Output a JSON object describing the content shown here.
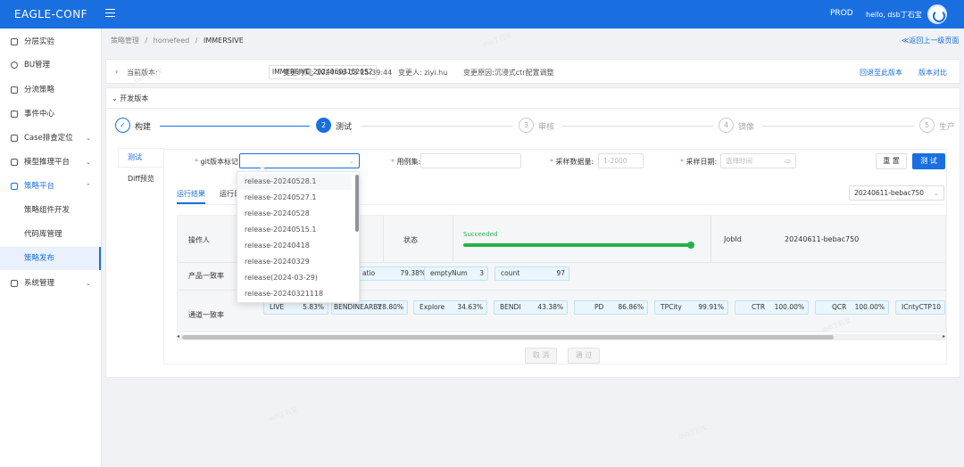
{
  "header": {
    "brand": "EAGLE-CONF",
    "env": "PROD",
    "greeting": "hello, dsb丁石宝"
  },
  "sidebar": {
    "items": [
      {
        "label": "分层实验",
        "icon": "layers-icon",
        "chevron": ""
      },
      {
        "label": "BU管理",
        "icon": "globe-icon",
        "chevron": ""
      },
      {
        "label": "分流策略",
        "icon": "branch-icon",
        "chevron": ""
      },
      {
        "label": "事件中心",
        "icon": "calendar-icon",
        "chevron": ""
      },
      {
        "label": "Case排查定位",
        "icon": "case-icon",
        "chevron": "⌄"
      },
      {
        "label": "模型推理平台",
        "icon": "model-icon",
        "chevron": "⌄"
      },
      {
        "label": "策略平台",
        "icon": "strategy-icon",
        "chevron": "⌃"
      }
    ],
    "subitems": [
      "策略组件开发",
      "代码库管理",
      "策略发布"
    ],
    "last": {
      "label": "系统管理",
      "icon": "list-icon",
      "chevron": "⌄"
    }
  },
  "breadcrumb": [
    "策略管理",
    "/",
    "homefeed",
    "/",
    "IMMERSIVE"
  ],
  "back_link": "≪返回上一级页面",
  "version_bar": {
    "current_label": "当前版本:",
    "current_value": "IMMERSIVE_20240603152052",
    "time_label": "变更时间: 2024-06-03 15:39:44",
    "person_label": "变更人: ziyi.hu",
    "reason_label": "变更原因:沉浸式ctr配置调整",
    "rollback": "回退至此版本",
    "compare": "版本对比"
  },
  "dev_section": {
    "title": "开发版本",
    "steps": [
      {
        "num": "✓",
        "name": "构建"
      },
      {
        "num": "2",
        "name": "测试"
      },
      {
        "num": "3",
        "name": "审核"
      },
      {
        "num": "4",
        "name": "镜像"
      },
      {
        "num": "5",
        "name": "生产"
      }
    ],
    "vtabs": [
      "测试",
      "Diff预览"
    ]
  },
  "form": {
    "git_label": "git版本标记:",
    "case_label": "用例集:",
    "sample_label": "采样数据量:",
    "sample_placeholder": "1-2000",
    "date_label": "采样日期:",
    "date_placeholder": "选择时间",
    "reset": "重 置",
    "test": "测 试"
  },
  "result": {
    "tabs": [
      "运行结果",
      "运行日"
    ],
    "job_select": "20240611-bebac750",
    "row1_label": "操作人",
    "status_label": "状态",
    "status_value": "Succeeded",
    "progress": 1.0,
    "jobid_label": "JobId",
    "jobid_value": "20240611-bebac750",
    "row2_label": "产品一致率",
    "row2_chips": [
      {
        "k": "atio",
        "v": "79.38%"
      },
      {
        "k": "emptyNum",
        "v": "3"
      },
      {
        "k": "count",
        "v": "97"
      }
    ],
    "row3_label": "通道一致率",
    "row3_chips": [
      {
        "k": "LIVE",
        "v": "5.83%"
      },
      {
        "k": "BENDINEARBY",
        "v": "28.80%"
      },
      {
        "k": "Explore",
        "v": "34.63%"
      },
      {
        "k": "BENDI",
        "v": "43.38%"
      },
      {
        "k": "PD",
        "v": "86.86%"
      },
      {
        "k": "TPCity",
        "v": "99.91%"
      },
      {
        "k": "CTR",
        "v": "100.00%"
      },
      {
        "k": "QCR",
        "v": "100.00%"
      },
      {
        "k": "ICntyCTP",
        "v": "10"
      }
    ],
    "cancel": "取 消",
    "pass": "通 过"
  },
  "dropdown": {
    "options": [
      "release-20240528.1",
      "release-20240527.1",
      "release-20240528",
      "release-20240515.1",
      "release-20240418",
      "release-20240329",
      "release(2024-03-29)",
      "release-20240321118"
    ]
  },
  "watermark": "dsb丁石宝"
}
